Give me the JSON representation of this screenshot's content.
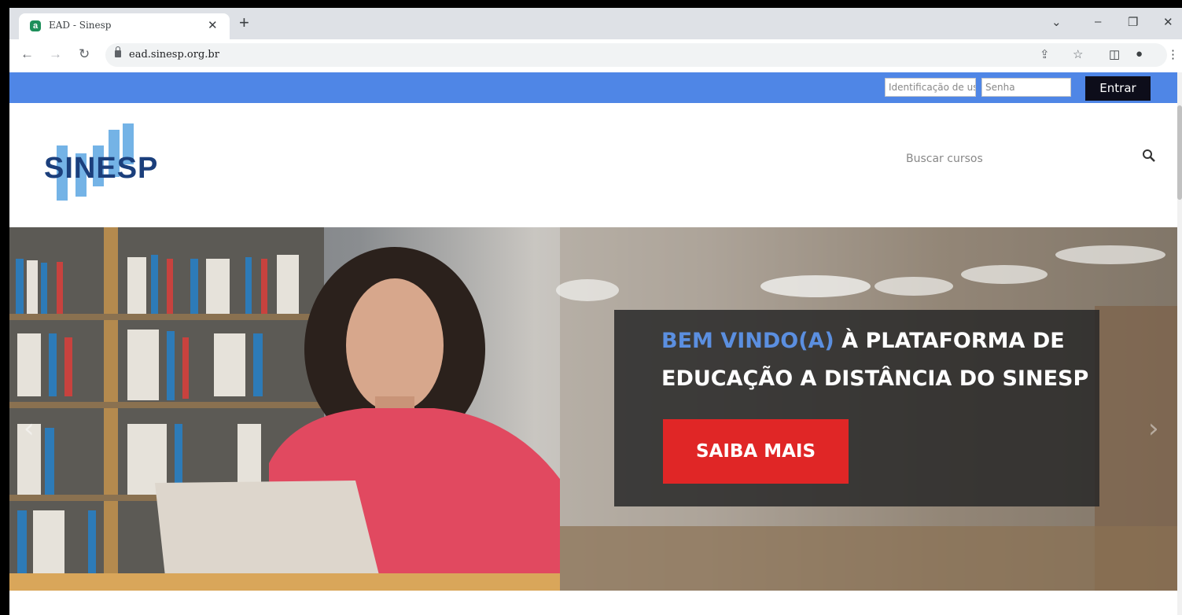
{
  "browser": {
    "tab_title": "EAD - Sinesp",
    "tab_favicon": "a",
    "url": "ead.sinesp.org.br",
    "icons": [
      "tab-close-icon",
      "new-tab-icon",
      "tab-search-icon",
      "minimize-icon",
      "restore-icon",
      "close-window-icon",
      "back-icon",
      "forward-icon",
      "reload-icon",
      "lock-icon",
      "share-icon",
      "bookmark-star-icon",
      "side-panel-icon",
      "profile-icon",
      "menu-icon"
    ]
  },
  "login": {
    "username_placeholder": "Identificação de usuário",
    "password_placeholder": "Senha",
    "submit_label": "Entrar"
  },
  "header": {
    "logo_text": "SINESP",
    "search_placeholder": "Buscar cursos"
  },
  "hero": {
    "highlight": "BEM VINDO(A)",
    "line1_rest": " À PLATAFORMA DE",
    "line2": "EDUCAÇÃO A DISTÂNCIA DO SINESP",
    "button_label": "SAIBA MAIS",
    "prev_arrow": "‹",
    "next_arrow": "›"
  },
  "colors": {
    "login_bar": "#4f86e6",
    "logo_blue": "#1b3f7c",
    "logo_light": "#74b3e6",
    "cta_red": "#e02626",
    "highlight_blue": "#5b8fe0"
  }
}
